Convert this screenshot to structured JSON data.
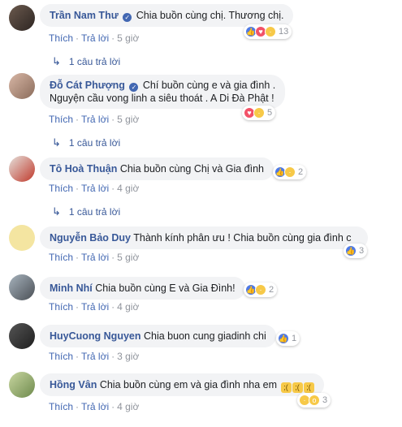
{
  "actions": {
    "like": "Thích",
    "reply": "Trả lời",
    "separator": "·"
  },
  "comments": [
    {
      "name": "Trần Nam Thư",
      "verified": true,
      "text": "Chia buồn cùng chị. Thương chị.",
      "reacts": [
        "like",
        "love",
        "sad"
      ],
      "count": "13",
      "time": "5 giờ",
      "replies": "1 câu trả lời"
    },
    {
      "name": "Đỗ Cát Phượng",
      "verified": true,
      "text": "Chí buồn cùng e và gia đình .",
      "text2": "Nguyện cầu vong linh a siêu thoát . A Di Đà Phật !",
      "reacts": [
        "love",
        "sad"
      ],
      "count": "5",
      "time": "5 giờ",
      "replies": "1 câu trả lời"
    },
    {
      "name": "Tô Hoà Thuận",
      "verified": false,
      "text": "Chia buồn cùng Chị và Gia đình",
      "reacts": [
        "like",
        "sad"
      ],
      "count": "2",
      "time": "4 giờ",
      "replies": "1 câu trả lời"
    },
    {
      "name": "Nguyễn Bảo Duy",
      "verified": false,
      "text": "Thành kính phân ưu ! Chia buồn cùng gia đình c",
      "reacts": [
        "like"
      ],
      "count": "3",
      "time": "5 giờ"
    },
    {
      "name": "Minh Nhí",
      "verified": false,
      "text": "Chia buồn cùng E và Gia Đình!",
      "reacts": [
        "like",
        "sad"
      ],
      "count": "2",
      "time": "4 giờ"
    },
    {
      "name": "HuyCuong Nguyen",
      "verified": false,
      "text": "Chia buon cung giadinh chi",
      "reacts": [
        "like"
      ],
      "count": "1",
      "time": "3 giờ"
    },
    {
      "name": "Hồng Vân",
      "verified": false,
      "text": "Chia buồn cùng em và gia đình nha em",
      "emoji_count": 3,
      "reacts": [
        "sad",
        "wow"
      ],
      "count": "3",
      "time": "4 giờ"
    }
  ],
  "colors": {
    "name": "#385898",
    "bubble": "#f2f3f5",
    "link": "#4267b2",
    "meta": "#90949c"
  },
  "icons": {
    "verified": "verified-badge-icon",
    "reply_arrow": "reply-arrow-icon",
    "like": "like-icon",
    "love": "love-icon",
    "sad": "sad-icon",
    "wow": "wow-icon"
  }
}
